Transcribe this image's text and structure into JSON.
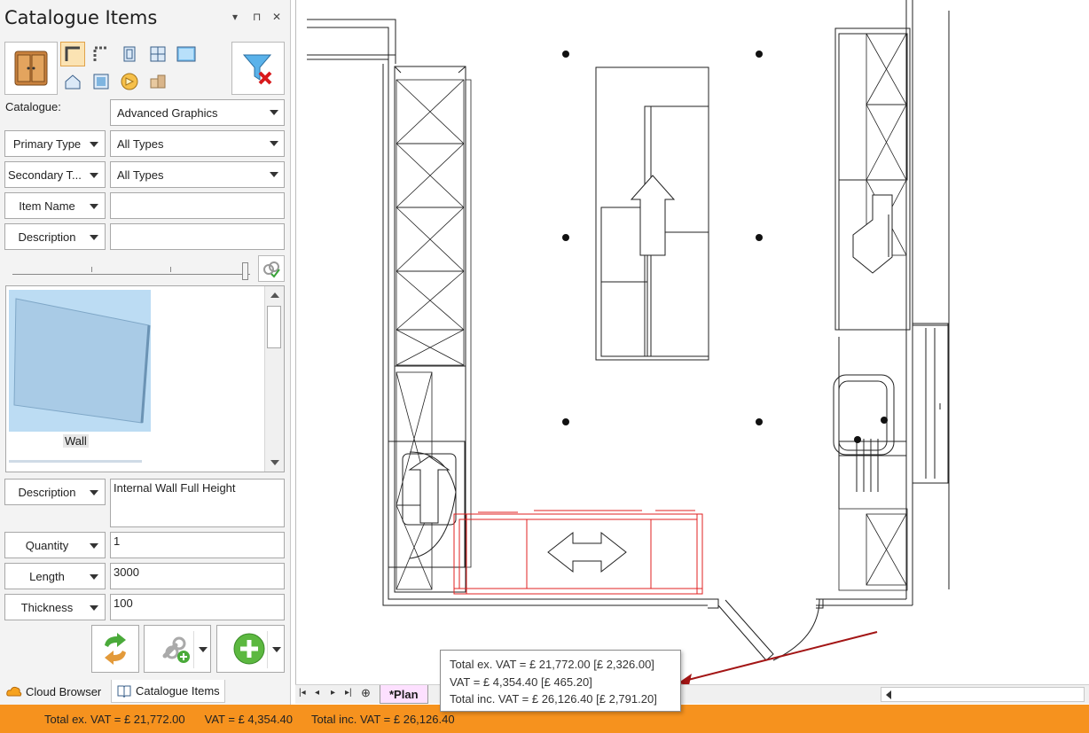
{
  "panel": {
    "title": "Catalogue Items",
    "controls": {
      "dropdown": "▾",
      "pin": "⊓",
      "close": "✕"
    },
    "catalogue_label": "Catalogue:",
    "catalogue_value": "Advanced Graphics",
    "primary_type_label": "Primary Type",
    "primary_type_value": "All Types",
    "secondary_type_label": "Secondary T...",
    "secondary_type_value": "All Types",
    "item_name_label": "Item Name",
    "item_name_value": "",
    "description_filter_label": "Description",
    "description_filter_value": "",
    "gallery": {
      "selected_item": "Wall"
    },
    "properties": {
      "description_label": "Description",
      "description_value": "Internal Wall Full Height",
      "quantity_label": "Quantity",
      "quantity_value": "1",
      "length_label": "Length",
      "length_value": "3000",
      "thickness_label": "Thickness",
      "thickness_value": "100"
    },
    "tabs": [
      {
        "label": "Cloud Browser",
        "icon": "cloud-icon"
      },
      {
        "label": "Catalogue Items",
        "icon": "book-icon"
      }
    ]
  },
  "sheet": {
    "tab_label": "*Plan"
  },
  "tooltip": {
    "line1": "Total ex. VAT = £ 21,772.00 [£ 2,326.00]",
    "line2": "VAT = £ 4,354.40 [£ 465.20]",
    "line3": "Total inc. VAT = £ 26,126.40 [£ 2,791.20]"
  },
  "status": {
    "total_ex_vat": "Total ex. VAT = £ 21,772.00",
    "vat": "VAT = £ 4,354.40",
    "total_inc_vat": "Total inc. VAT = £ 26,126.40"
  },
  "colors": {
    "status_bar": "#f6921e",
    "selection": "#e02020",
    "plan_tab": "#fde0ff",
    "arrow": "#a31515"
  }
}
